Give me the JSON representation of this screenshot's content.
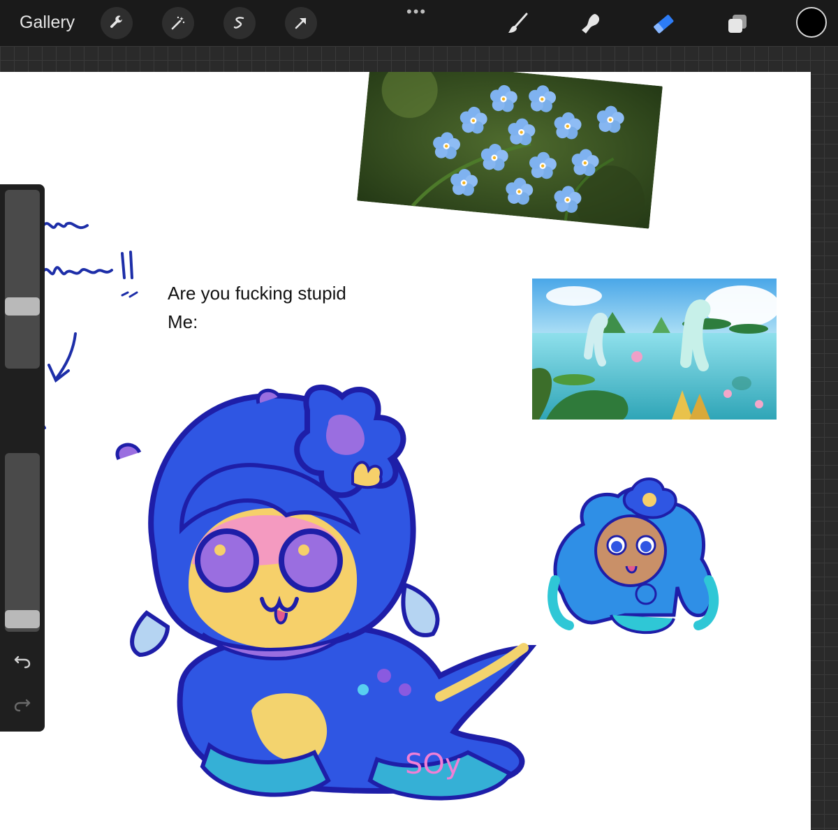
{
  "toolbar": {
    "gallery_label": "Gallery",
    "left_tools": [
      {
        "name": "wrench-icon",
        "label": "Actions"
      },
      {
        "name": "magic-wand-icon",
        "label": "Adjustments"
      },
      {
        "name": "selection-icon",
        "label": "Selection"
      },
      {
        "name": "transform-arrow-icon",
        "label": "Transform"
      }
    ],
    "more_icon": "more-dots-icon",
    "right_tools": [
      {
        "name": "brush-icon",
        "active": false
      },
      {
        "name": "smudge-icon",
        "active": false
      },
      {
        "name": "eraser-icon",
        "active": true
      },
      {
        "name": "layers-icon",
        "active": false
      }
    ],
    "current_color": "#000000",
    "accent_color": "#2d7cf6"
  },
  "canvas": {
    "text_line_1": "Are you fucking stupid",
    "text_line_2": "Me:",
    "signature": "SOy",
    "images": [
      {
        "name": "forget-me-not-photo",
        "subject": "blue forget-me-not flowers"
      },
      {
        "name": "nessie-lake-illustration",
        "subject": "sea serpents in a lily pad lake"
      }
    ]
  },
  "sidebar": {
    "brush_size_level": 0.67,
    "opacity_level": 0.98,
    "icons": [
      "modify-square-icon",
      "undo-icon",
      "redo-icon"
    ]
  }
}
